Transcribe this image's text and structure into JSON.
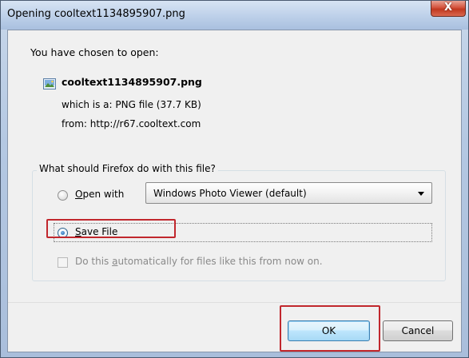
{
  "window": {
    "title": "Opening cooltext1134895907.png",
    "close_label": "X"
  },
  "download": {
    "intro": "You have chosen to open:",
    "file_icon": "image-file-icon",
    "file_name": "cooltext1134895907.png",
    "which_is": "which is a:  PNG file (37.7 KB)",
    "from": "from:  http://r67.cooltext.com"
  },
  "action_group": {
    "legend": "What should Firefox do with this file?",
    "open_with": {
      "accel": "O",
      "rest": "pen with",
      "checked": false
    },
    "application_select": {
      "selected": "Windows Photo Viewer (default)"
    },
    "save_file": {
      "accel": "S",
      "rest": "ave File",
      "checked": true
    },
    "auto_checkbox": {
      "prefix": "Do this ",
      "accel": "a",
      "rest": "utomatically for files like this from now on.",
      "checked": false,
      "enabled": false
    }
  },
  "buttons": {
    "ok": "OK",
    "cancel": "Cancel"
  },
  "colors": {
    "highlight": "#c1272d",
    "titlebar": "#bfd2ea",
    "close_button": "#d4523c"
  }
}
